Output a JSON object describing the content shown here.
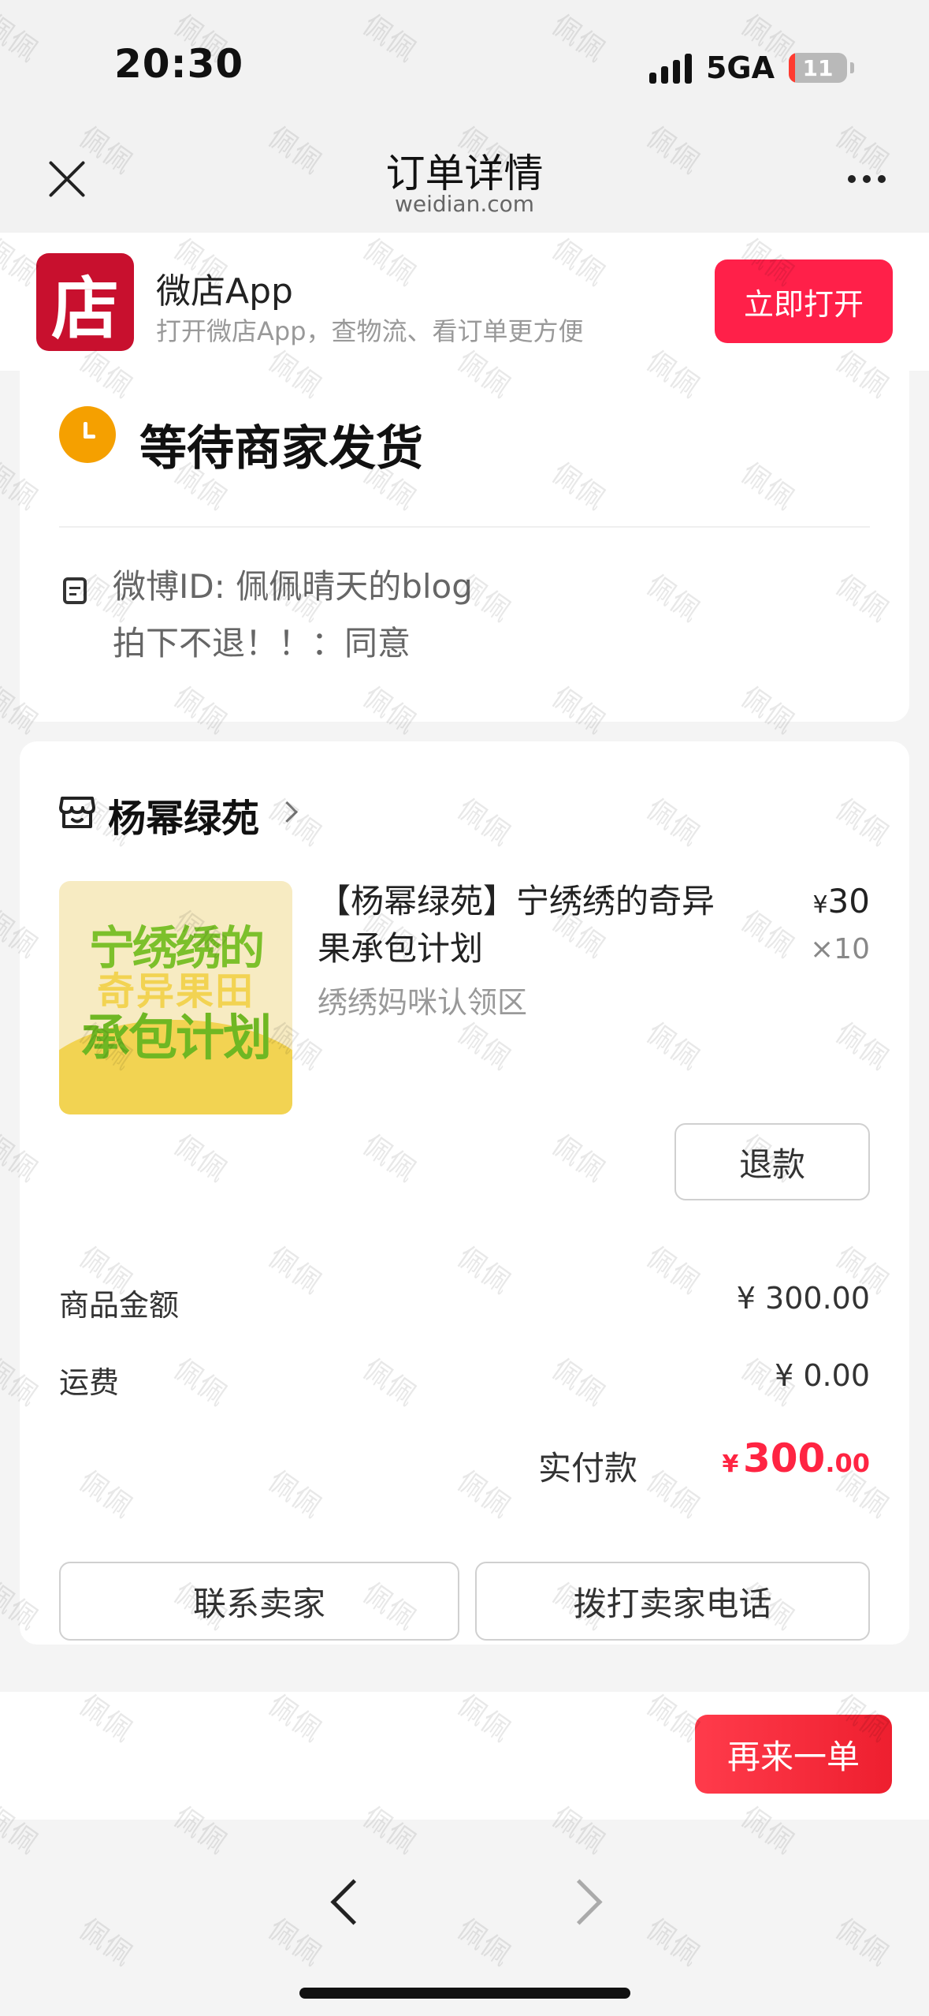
{
  "status_bar": {
    "time": "20:30",
    "network": "5GA",
    "battery": "11",
    "battery_level": 0.11
  },
  "nav": {
    "title": "订单详情",
    "subtitle": "weidian.com",
    "close_icon": "close-icon",
    "more_icon": "more-icon"
  },
  "app_banner": {
    "logo_char": "店",
    "name": "微店App",
    "desc": "打开微店App，查物流、看订单更方便",
    "open_label": "立即打开"
  },
  "order_status": {
    "text": "等待商家发货",
    "notes": [
      "微博ID: 佩佩晴天的blog",
      "拍下不退！！：同意"
    ]
  },
  "shop": {
    "name": "杨幂绿苑"
  },
  "product": {
    "image_text": [
      "宁绣绣的",
      "奇异果田",
      "承包计划"
    ],
    "title": "【杨幂绿苑】宁绣绣的奇异果承包计划",
    "spec": "绣绣妈咪认领区",
    "currency": "¥",
    "price": "30",
    "qty": "×10",
    "refund_label": "退款"
  },
  "summary": {
    "goods_label": "商品金额",
    "goods_value": "¥ 300.00",
    "shipping_label": "运费",
    "shipping_value": "¥ 0.00",
    "paid_label": "实付款",
    "paid_currency": "¥",
    "paid_int": "300",
    "paid_dec": ".00"
  },
  "actions": {
    "contact_label": "联系卖家",
    "call_label": "拨打卖家电话",
    "reorder_label": "再来一单"
  },
  "browser": {
    "back_icon": "chevron-left-icon",
    "forward_icon": "chevron-right-icon"
  },
  "watermark_text": "佩佩",
  "colors": {
    "accent": "#ff2049",
    "status_orange": "#f5a000",
    "price_red": "#ff2442",
    "logo_red": "#c8102e"
  }
}
